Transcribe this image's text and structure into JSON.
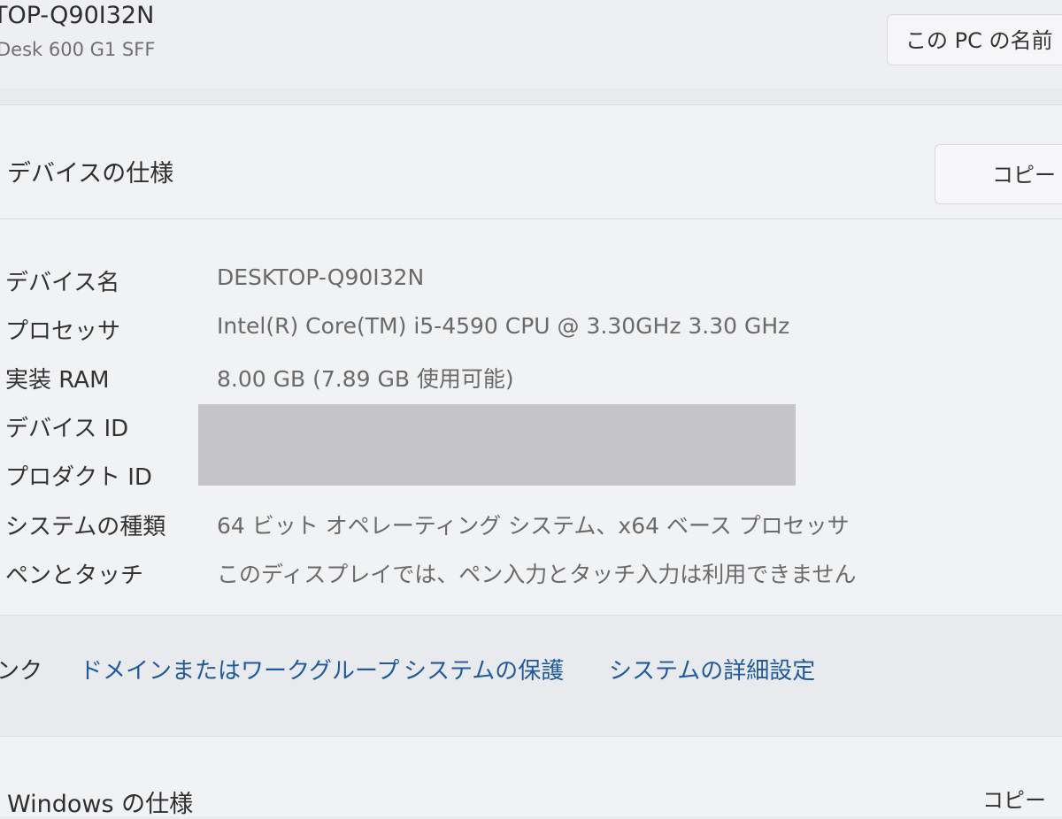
{
  "header": {
    "device_name": "TOP-Q90I32N",
    "device_model": "Desk 600 G1 SFF",
    "rename_label": "この PC の名前"
  },
  "device_specs": {
    "title": "デバイスの仕様",
    "copy_label": "コピー",
    "rows": [
      {
        "label": "デバイス名",
        "value": "DESKTOP-Q90I32N"
      },
      {
        "label": "プロセッサ",
        "value": "Intel(R) Core(TM) i5-4590 CPU @ 3.30GHz   3.30 GHz"
      },
      {
        "label": "実装 RAM",
        "value": "8.00 GB (7.89 GB 使用可能)"
      },
      {
        "label": "デバイス ID",
        "value": ""
      },
      {
        "label": "プロダクト ID",
        "value": ""
      },
      {
        "label": "システムの種類",
        "value": "64 ビット オペレーティング システム、x64 ベース プロセッサ"
      },
      {
        "label": "ペンとタッチ",
        "value": "このディスプレイでは、ペン入力とタッチ入力は利用できません"
      }
    ]
  },
  "related_links": {
    "label": "ンク",
    "links": [
      "ドメインまたはワークグループ",
      "システムの保護",
      "システムの詳細設定"
    ]
  },
  "windows_specs": {
    "title": "Windows の仕様",
    "copy_label": "コピー"
  }
}
